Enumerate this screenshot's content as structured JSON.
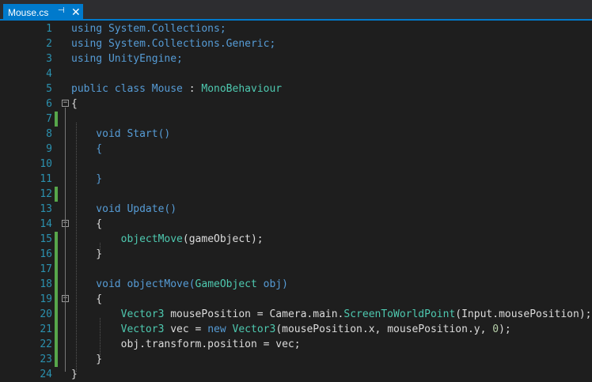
{
  "tab": {
    "filename": "Mouse.cs",
    "pin_glyph": "⊣",
    "close_glyph": "✕"
  },
  "lines": [
    {
      "n": "1",
      "changed": false,
      "fold": "",
      "tokens": [
        {
          "t": "using System.Collections;",
          "c": "kw"
        }
      ]
    },
    {
      "n": "2",
      "changed": false,
      "fold": "",
      "tokens": [
        {
          "t": "using System.Collections.Generic;",
          "c": "kw"
        }
      ]
    },
    {
      "n": "3",
      "changed": false,
      "fold": "",
      "tokens": [
        {
          "t": "using UnityEngine;",
          "c": "kw"
        }
      ]
    },
    {
      "n": "4",
      "changed": false,
      "fold": "",
      "tokens": []
    },
    {
      "n": "5",
      "changed": false,
      "fold": "",
      "tokens": [
        {
          "t": "public class Mouse",
          "c": "kw"
        },
        {
          "t": " : ",
          "c": "op"
        },
        {
          "t": "MonoBehaviour",
          "c": "ty"
        }
      ]
    },
    {
      "n": "6",
      "changed": false,
      "fold": "−",
      "tokens": [
        {
          "t": "{",
          "c": "op"
        }
      ]
    },
    {
      "n": "7",
      "changed": true,
      "fold": "",
      "tokens": []
    },
    {
      "n": "8",
      "changed": false,
      "fold": "",
      "tokens": [
        {
          "t": "    void Start()",
          "c": "kw"
        }
      ]
    },
    {
      "n": "9",
      "changed": false,
      "fold": "",
      "tokens": [
        {
          "t": "    {",
          "c": "kw"
        }
      ]
    },
    {
      "n": "10",
      "changed": false,
      "fold": "",
      "tokens": []
    },
    {
      "n": "11",
      "changed": false,
      "fold": "",
      "tokens": [
        {
          "t": "    }",
          "c": "kw"
        }
      ]
    },
    {
      "n": "12",
      "changed": true,
      "fold": "",
      "tokens": []
    },
    {
      "n": "13",
      "changed": false,
      "fold": "",
      "tokens": [
        {
          "t": "    void Update()",
          "c": "kw"
        }
      ]
    },
    {
      "n": "14",
      "changed": false,
      "fold": "−",
      "tokens": [
        {
          "t": "    {",
          "c": "op"
        }
      ]
    },
    {
      "n": "15",
      "changed": true,
      "fold": "",
      "tokens": [
        {
          "t": "        objectMove",
          "c": "ty"
        },
        {
          "t": "(gameObject);",
          "c": "op"
        }
      ]
    },
    {
      "n": "16",
      "changed": true,
      "fold": "",
      "tokens": [
        {
          "t": "    }",
          "c": "op"
        }
      ]
    },
    {
      "n": "17",
      "changed": true,
      "fold": "",
      "tokens": []
    },
    {
      "n": "18",
      "changed": true,
      "fold": "",
      "tokens": [
        {
          "t": "    void objectMove(",
          "c": "kw"
        },
        {
          "t": "GameObject",
          "c": "ty"
        },
        {
          "t": " obj)",
          "c": "kw"
        }
      ]
    },
    {
      "n": "19",
      "changed": true,
      "fold": "−",
      "tokens": [
        {
          "t": "    {",
          "c": "op"
        }
      ]
    },
    {
      "n": "20",
      "changed": true,
      "fold": "",
      "tokens": [
        {
          "t": "        Vector3",
          "c": "ty"
        },
        {
          "t": " mousePosition = Camera.main.",
          "c": "op"
        },
        {
          "t": "ScreenToWorldPoint",
          "c": "ty"
        },
        {
          "t": "(Input.mousePosition);",
          "c": "op"
        }
      ]
    },
    {
      "n": "21",
      "changed": true,
      "fold": "",
      "tokens": [
        {
          "t": "        Vector3",
          "c": "ty"
        },
        {
          "t": " vec = ",
          "c": "op"
        },
        {
          "t": "new",
          "c": "kw"
        },
        {
          "t": " ",
          "c": "op"
        },
        {
          "t": "Vector3",
          "c": "ty"
        },
        {
          "t": "(mousePosition.x, mousePosition.y, ",
          "c": "op"
        },
        {
          "t": "0",
          "c": "nm"
        },
        {
          "t": ");",
          "c": "op"
        }
      ]
    },
    {
      "n": "22",
      "changed": true,
      "fold": "",
      "tokens": [
        {
          "t": "        obj.transform.position = vec;",
          "c": "op"
        }
      ]
    },
    {
      "n": "23",
      "changed": true,
      "fold": "",
      "tokens": [
        {
          "t": "    }",
          "c": "op"
        }
      ]
    },
    {
      "n": "24",
      "changed": false,
      "fold": "",
      "tokens": [
        {
          "t": "}",
          "c": "op"
        }
      ]
    }
  ]
}
